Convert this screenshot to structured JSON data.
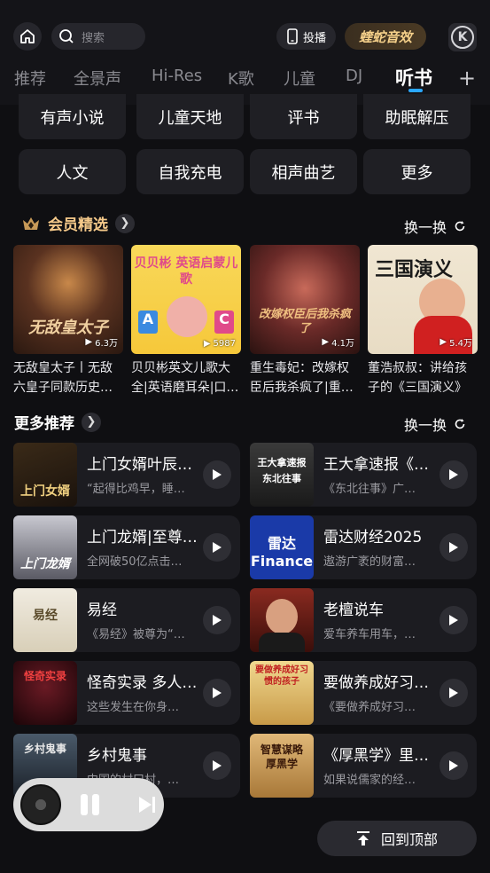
{
  "header": {
    "search_placeholder": "搜索",
    "cast_label": "投播",
    "sound_effect_label": "蝰蛇音效",
    "k_logo": "K"
  },
  "tabs": [
    {
      "label": "推荐",
      "active": false
    },
    {
      "label": "全景声",
      "active": false
    },
    {
      "label": "Hi-Res",
      "active": false
    },
    {
      "label": "K歌",
      "active": false
    },
    {
      "label": "儿童",
      "active": false
    },
    {
      "label": "DJ",
      "active": false
    },
    {
      "label": "听书",
      "active": true
    }
  ],
  "categories": [
    "有声小说",
    "儿童天地",
    "评书",
    "助眠解压",
    "人文",
    "自我充电",
    "相声曲艺",
    "更多"
  ],
  "vip_section": {
    "title": "会员精选",
    "refresh_label": "换一换",
    "items": [
      {
        "title": "无敌皇太子丨无敌六皇子同款历史…",
        "play_count": "6.3万",
        "cover_text": "无敌皇太子",
        "cover_color": "#3a2418"
      },
      {
        "title": "贝贝彬英文儿歌大全|英语磨耳朵|口…",
        "play_count": "5987",
        "cover_text": "贝贝彬 英语启蒙儿歌",
        "cover_color": "#f6d24a"
      },
      {
        "title": "重生毒妃：改嫁权臣后我杀疯了|重…",
        "play_count": "4.1万",
        "cover_text": "改嫁权臣后我杀疯了",
        "cover_color": "#5a2a28"
      },
      {
        "title": "董浩叔叔：讲给孩子的《三国演义》",
        "play_count": "5.4万",
        "cover_text": "三国演义",
        "cover_color": "#f0e6d2"
      }
    ]
  },
  "more_section": {
    "title": "更多推荐",
    "refresh_label": "换一换",
    "items": [
      {
        "title": "上门女婿叶辰…",
        "subtitle": "“起得比鸡早，睡…",
        "cover_text": "上门女婿",
        "cover_color": "#2a2018"
      },
      {
        "title": "王大拿速报《…",
        "subtitle": "《东北往事》广…",
        "cover_text": "王大拿速报 东北往事",
        "cover_color": "#2c2c2c"
      },
      {
        "title": "上门龙婿|至尊…",
        "subtitle": "全网破50亿点击…",
        "cover_text": "上门龙婿",
        "cover_color": "#6a6a70"
      },
      {
        "title": "雷达财经2025",
        "subtitle": "遨游广袤的财富…",
        "cover_text": "雷达 Finance",
        "cover_color": "#1a3aa8"
      },
      {
        "title": "易经",
        "subtitle": "《易经》被尊为“…",
        "cover_text": "易经",
        "cover_color": "#e8e2d2"
      },
      {
        "title": "老檀说车",
        "subtitle": "爱车养车用车，…",
        "cover_text": "",
        "cover_color": "#6a1a14"
      },
      {
        "title": "怪奇实录 多人…",
        "subtitle": "这些发生在你身…",
        "cover_text": "怪奇实录",
        "cover_color": "#3a0e14"
      },
      {
        "title": "要做养成好习…",
        "subtitle": "《要做养成好习…",
        "cover_text": "要做养成好习惯的孩子",
        "cover_color": "#d8b860"
      },
      {
        "title": "乡村鬼事",
        "subtitle": "中国的村口村，…",
        "cover_text": "乡村鬼事",
        "cover_color": "#2a3440"
      },
      {
        "title": "《厚黑学》里…",
        "subtitle": "如果说儒家的经…",
        "cover_text": "智慧谋略 厚黑学",
        "cover_color": "#c8a060"
      }
    ]
  },
  "back_to_top_label": "回到顶部",
  "colors": {
    "accent": "#2aa7ff",
    "vip_gold": "#f5c98a"
  }
}
